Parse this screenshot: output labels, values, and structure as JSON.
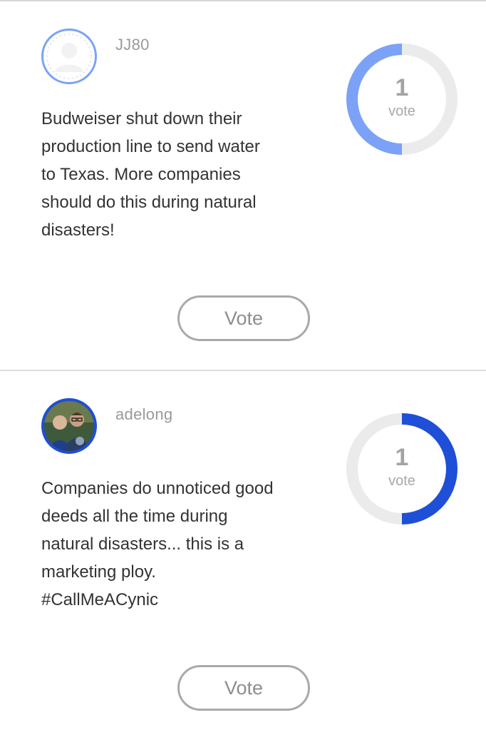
{
  "posts": [
    {
      "username": "JJ80",
      "avatar": "placeholder-user-icon",
      "text": "Budweiser shut down their\nproduction line to send water\nto Texas. More companies\nshould do this during natural\ndisasters!",
      "vote_count": "1",
      "vote_word": "vote",
      "vote_share": 0.5,
      "ring_color": "#7ba2f7",
      "ring_side": "left",
      "vote_button_label": "Vote"
    },
    {
      "username": "adelong",
      "avatar": "photo-two-people",
      "text": "Companies do unnoticed good\ndeeds all the time during\nnatural disasters... this is a\nmarketing ploy.\n#CallMeACynic",
      "vote_count": "1",
      "vote_word": "vote",
      "vote_share": 0.5,
      "ring_color": "#1f4fd6",
      "ring_side": "right",
      "vote_button_label": "Vote"
    }
  ],
  "colors": {
    "ring_track": "#ebebeb",
    "divider": "#dddddd"
  }
}
